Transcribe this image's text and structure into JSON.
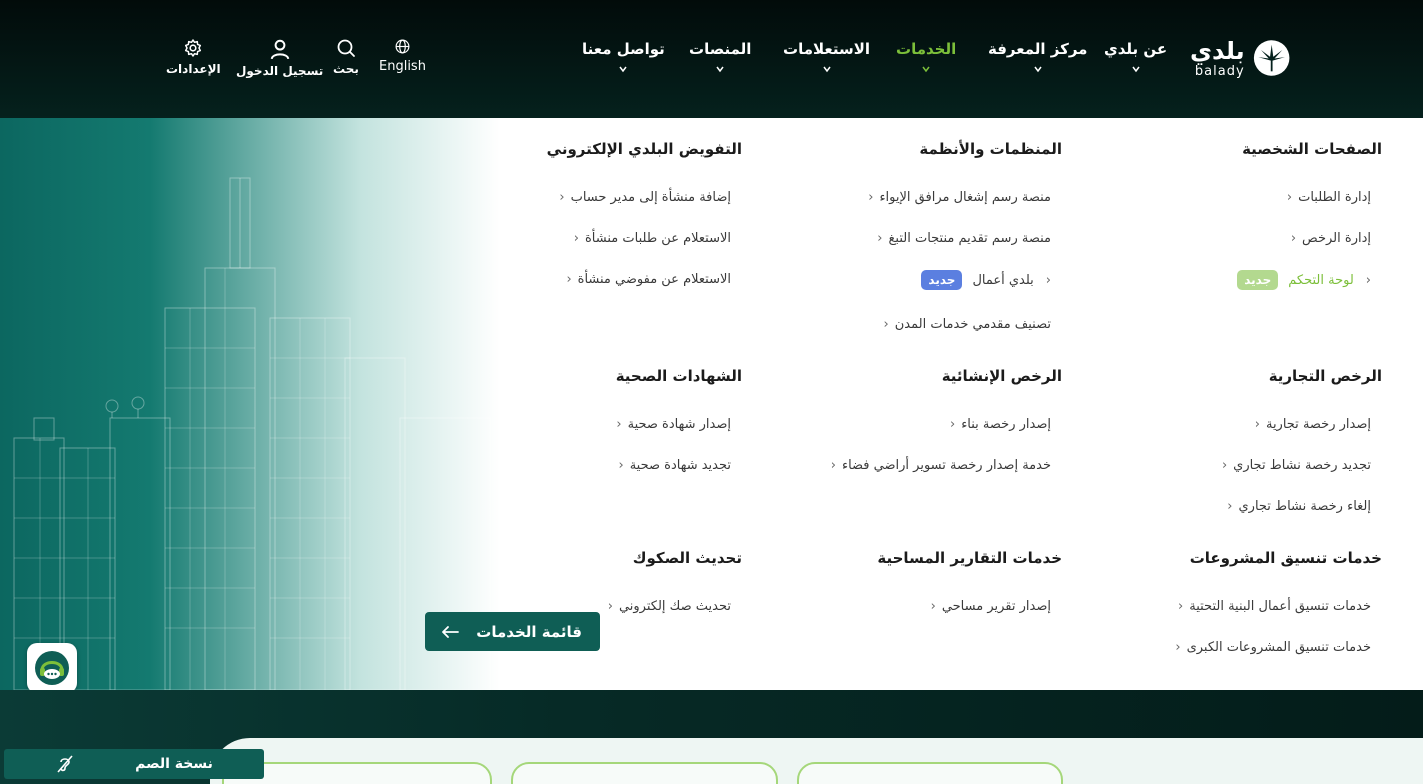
{
  "header": {
    "logo": {
      "arabic": "بلدي",
      "english": "balady"
    },
    "nav": [
      {
        "label": "عن بلدي",
        "active": false
      },
      {
        "label": "مركز المعرفة",
        "active": false
      },
      {
        "label": "الخدمات",
        "active": true
      },
      {
        "label": "الاستعلامات",
        "active": false
      },
      {
        "label": "المنصات",
        "active": false
      },
      {
        "label": "تواصل معنا",
        "active": false
      }
    ],
    "utilities": {
      "language": "English",
      "search": "بحث",
      "login": "تسجيل الدخول",
      "settings": "الإعدادات"
    }
  },
  "menu": {
    "columns": [
      {
        "title": "الصفحات الشخصية",
        "links": [
          "إدارة الطلبات",
          "إدارة الرخص",
          "لوحة التحكم"
        ],
        "badge_label": "جديد"
      },
      {
        "title": "المنظمات والأنظمة",
        "links": [
          "منصة رسم إشغال مرافق الإيواء",
          "منصة رسم تقديم منتجات التبغ",
          "بلدي أعمال",
          "تصنيف مقدمي خدمات المدن"
        ],
        "badge_label": "جديد"
      },
      {
        "title": "التفويض البلدي الإلكتروني",
        "links": [
          "إضافة منشأة إلى مدير حساب",
          "الاستعلام عن طلبات منشأة",
          "الاستعلام عن مفوضي منشأة"
        ]
      },
      {
        "title": "الرخص التجارية",
        "links": [
          "إصدار رخصة تجارية",
          "تجديد رخصة نشاط تجاري",
          "إلغاء رخصة نشاط تجاري"
        ]
      },
      {
        "title": "الرخص الإنشائية",
        "links": [
          "إصدار رخصة بناء",
          "خدمة إصدار رخصة تسوير أراضي فضاء"
        ]
      },
      {
        "title": "الشهادات الصحية",
        "links": [
          "إصدار شهادة صحية",
          "تجديد شهادة صحية"
        ]
      },
      {
        "title": "خدمات تنسيق المشروعات",
        "links": [
          "خدمات تنسيق أعمال البنية التحتية",
          "خدمات تنسيق المشروعات الكبرى"
        ]
      },
      {
        "title": "خدمات التقارير المساحية",
        "links": [
          "إصدار تقرير مساحي"
        ]
      },
      {
        "title": "تحديث الصكوك",
        "links": [
          "تحديث صك إلكتروني"
        ]
      }
    ],
    "services_button": "قائمة الخدمات"
  },
  "footer": {
    "deaf_version": "نسخة الصم"
  },
  "colors": {
    "brand_green": "#7cbf3a",
    "brand_teal": "#0f5e55",
    "badge_blue": "#5b7fe0",
    "badge_green": "#b3d98f",
    "header_bg": "#020b0a"
  }
}
